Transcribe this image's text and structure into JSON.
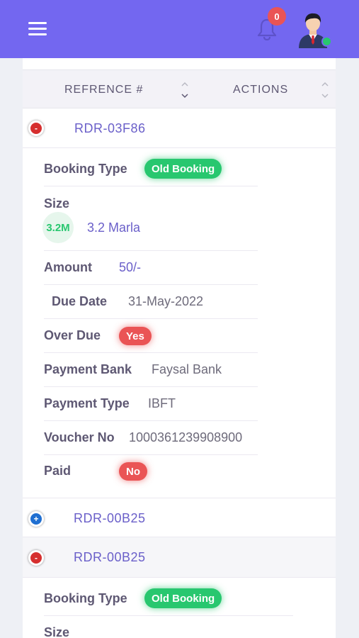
{
  "header": {
    "menu_icon": "hamburger-menu-icon",
    "bell_icon": "bell-icon",
    "notification_count": "0",
    "avatar_icon": "user-avatar-icon",
    "status": "online",
    "colors": {
      "bar": "#7367f0",
      "badge": "#ea5455",
      "online": "#28c76f"
    }
  },
  "table": {
    "columns": [
      "REFRENCE #",
      "ACTIONS"
    ]
  },
  "expanded_record": {
    "ref": "RDR-03F86",
    "toggle": "-",
    "booking_type_label": "Booking Type",
    "booking_type": "Old Booking",
    "size_label": "Size",
    "size_avatar": "3.2M",
    "size": "3.2 Marla",
    "amount_label": "Amount",
    "amount": "50/-",
    "due_date_label": "Due Date",
    "due_date": "31-May-2022",
    "over_due_label": "Over Due",
    "over_due": "Yes",
    "payment_bank_label": "Payment Bank",
    "payment_bank": "Faysal Bank",
    "payment_type_label": "Payment Type",
    "payment_type": "IBFT",
    "voucher_label": "Voucher No",
    "voucher": "1000361239908900",
    "paid_label": "Paid",
    "paid": "No"
  },
  "collapsed_record": {
    "ref": "RDR-00B25",
    "toggle": "+"
  },
  "second_expanded_record": {
    "ref": "RDR-00B25",
    "toggle": "-",
    "booking_type_label": "Booking Type",
    "booking_type": "Old Booking",
    "size_label": "Size"
  }
}
